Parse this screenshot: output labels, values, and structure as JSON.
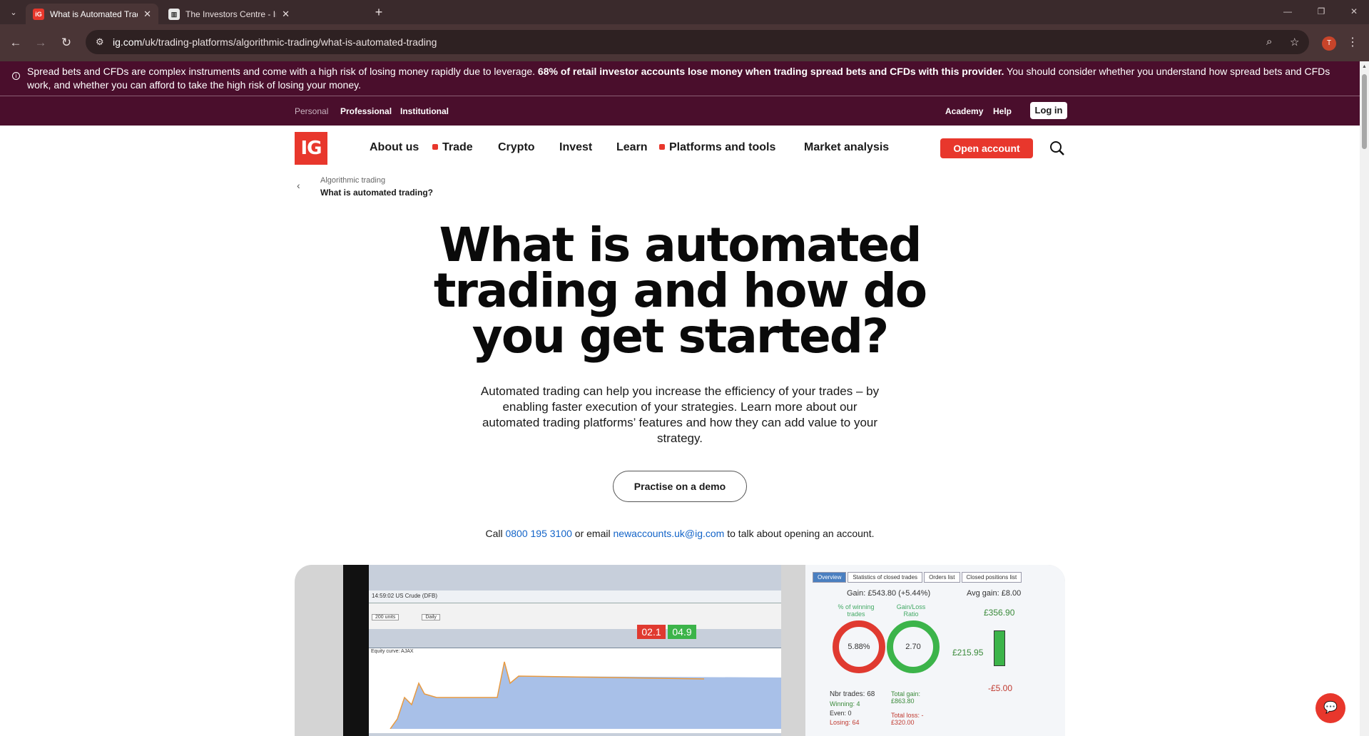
{
  "browser": {
    "tabs": [
      {
        "title": "What is Automated Trading and",
        "active": true,
        "favicon": "ig-favicon"
      },
      {
        "title": "The Investors Centre - Investing",
        "active": false,
        "favicon": "ic-favicon"
      }
    ],
    "url_host": "ig.com",
    "url_path": "/uk/trading-platforms/algorithmic-trading/what-is-automated-trading",
    "profile_initial": "T"
  },
  "risk_banner": {
    "text_a": "Spread bets and CFDs are complex instruments and come with a high risk of losing money rapidly due to leverage. ",
    "text_bold": "68% of retail investor accounts lose money when trading spread bets and CFDs with this provider.",
    "text_b": " You should consider whether you understand how spread bets and CFDs work, and whether you can afford to take the high risk of losing your money."
  },
  "subnav": {
    "personal": "Personal",
    "professional": "Professional",
    "institutional": "Institutional",
    "academy": "Academy",
    "help": "Help",
    "login": "Log in"
  },
  "nav": {
    "logo": "IG",
    "about": "About us",
    "trade": "Trade",
    "crypto": "Crypto",
    "invest": "Invest",
    "learn": "Learn",
    "platforms": "Platforms and tools",
    "market": "Market analysis",
    "open_account": "Open account"
  },
  "breadcrumb": {
    "parent": "Algorithmic trading",
    "current": "What is automated trading?"
  },
  "hero": {
    "line1": "What is automated",
    "line2": "trading and how do",
    "line3": "you get started?",
    "intro": "Automated trading can help you increase the efficiency of your trades – by enabling faster execution of your strategies. Learn more about our automated trading platforms’ features and how they can add value to your strategy.",
    "demo_button": "Practise on a demo",
    "call_prefix": "Call ",
    "phone": "0800 195 3100",
    "call_mid": " or email ",
    "email": "newaccounts.uk@ig.com",
    "call_suffix": " to talk about opening an account."
  },
  "platform_shot": {
    "instrument": "14:59:02 US Crude (DFB)",
    "units": "200 units",
    "period": "Daily",
    "equity_label": "Equity curve: AJAX",
    "sell": "02.1",
    "buy": "04.9",
    "tabs": [
      "Overview",
      "Statistics of closed trades",
      "Orders list",
      "Closed positions list"
    ],
    "gain": "Gain: £543.80 (+5.44%)",
    "winning_label": "% of winning trades",
    "winning_pct": "5.88%",
    "ratio_label": "Gain/Loss Ratio",
    "ratio": "2.70",
    "avg_gain": "Avg gain: £8.00",
    "best_trade": "£356.90",
    "avg_gain_val": "£215.95",
    "worst_trade": "-£5.00",
    "nbr_trades": "Nbr trades: 68",
    "winning": "Winning: 4",
    "even": "Even: 0",
    "losing": "Losing: 64",
    "total_gain": "Total gain: £863.80",
    "total_loss": "Total loss: -£320.00"
  }
}
